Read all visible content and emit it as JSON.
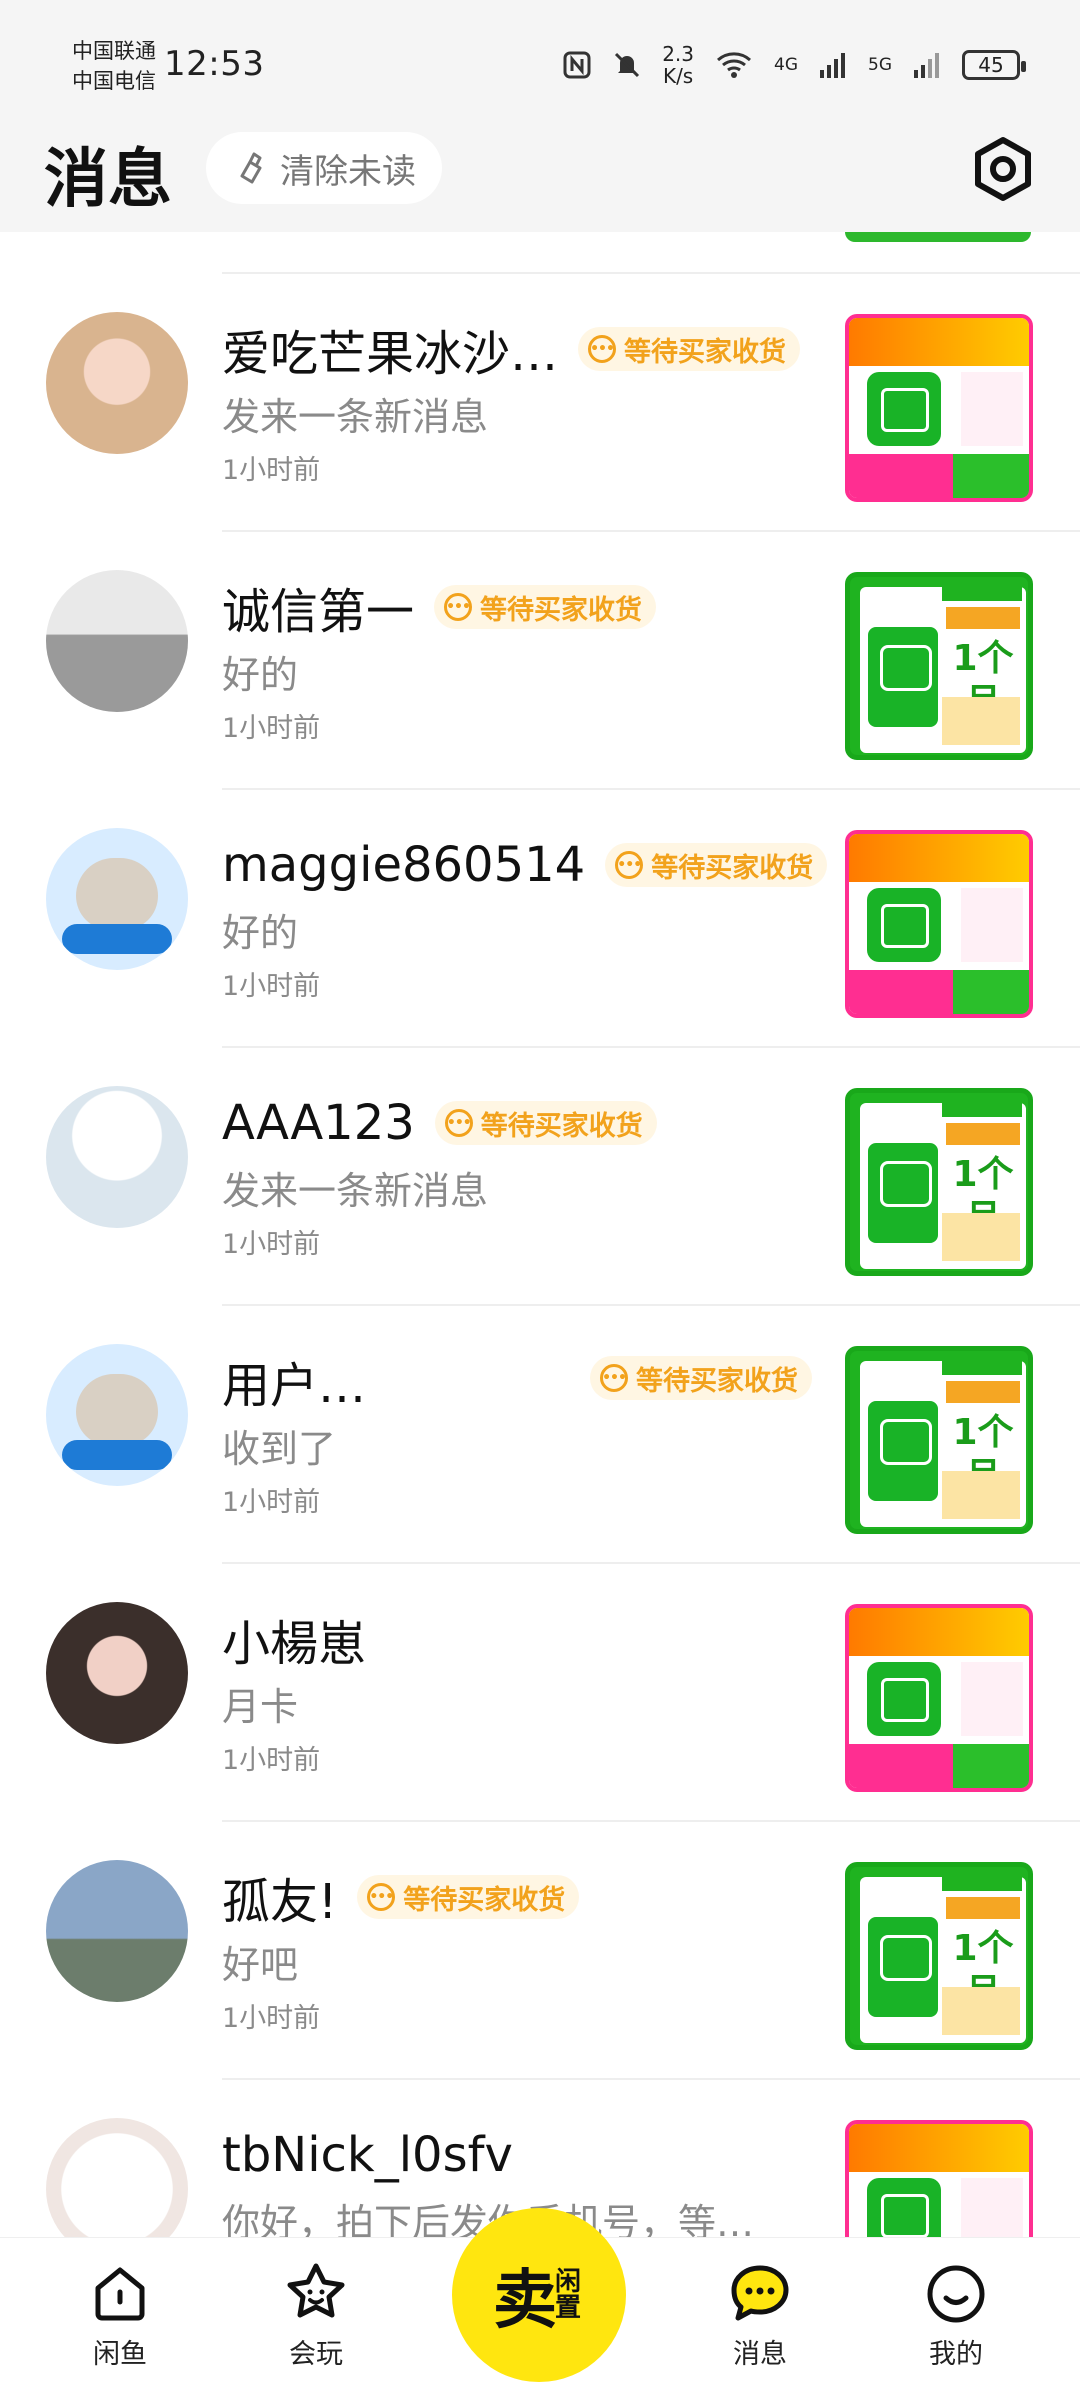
{
  "status_bar": {
    "carrier_1": "中国联通",
    "carrier_2": "中国电信",
    "time": "12:53",
    "net_speed_value": "2.3",
    "net_speed_unit": "K/s",
    "signal_1": "4G",
    "signal_2": "5G",
    "battery": "45"
  },
  "header": {
    "title": "消息",
    "clear_unread": "清除未读"
  },
  "messages": [
    {
      "name": "爱吃芒果冰沙…",
      "badge": "等待买家收货",
      "preview": "发来一条新消息",
      "time": "1小时前",
      "thumb": "pink"
    },
    {
      "name": "诚信第一",
      "badge": "等待买家收货",
      "preview": "好的",
      "time": "1小时前",
      "thumb": "green"
    },
    {
      "name": "maggie860514",
      "badge": "等待买家收货",
      "preview": "好的",
      "time": "1小时前",
      "thumb": "pink"
    },
    {
      "name": "AAA123",
      "badge": "等待买家收货",
      "preview": "发来一条新消息",
      "time": "1小时前",
      "thumb": "green"
    },
    {
      "name": "用户…",
      "badge": "等待买家收货",
      "preview": "收到了",
      "time": "1小时前",
      "thumb": "green"
    },
    {
      "name": "小楊崽",
      "badge": "",
      "preview": "月卡",
      "time": "1小时前",
      "thumb": "pink"
    },
    {
      "name": "孤友!",
      "badge": "等待买家收货",
      "preview": "好吧",
      "time": "1小时前",
      "thumb": "green"
    },
    {
      "name": "tbNick_l0sfv",
      "badge": "",
      "preview": "你好，拍下后发你手机号，等…",
      "time": "",
      "thumb": "pink"
    }
  ],
  "thumb_text": {
    "green_month": "1个月"
  },
  "bottom_nav": {
    "home": "闲鱼",
    "play": "会玩",
    "sell_main": "卖",
    "sell_sub": "闲置",
    "messages": "消息",
    "mine": "我的"
  },
  "colors": {
    "accent_yellow": "#ffe60f",
    "badge_orange": "#f2a21c",
    "badge_bg": "#fff6e3",
    "thumb_green": "#1fb320",
    "thumb_pink": "#ff2e91"
  }
}
